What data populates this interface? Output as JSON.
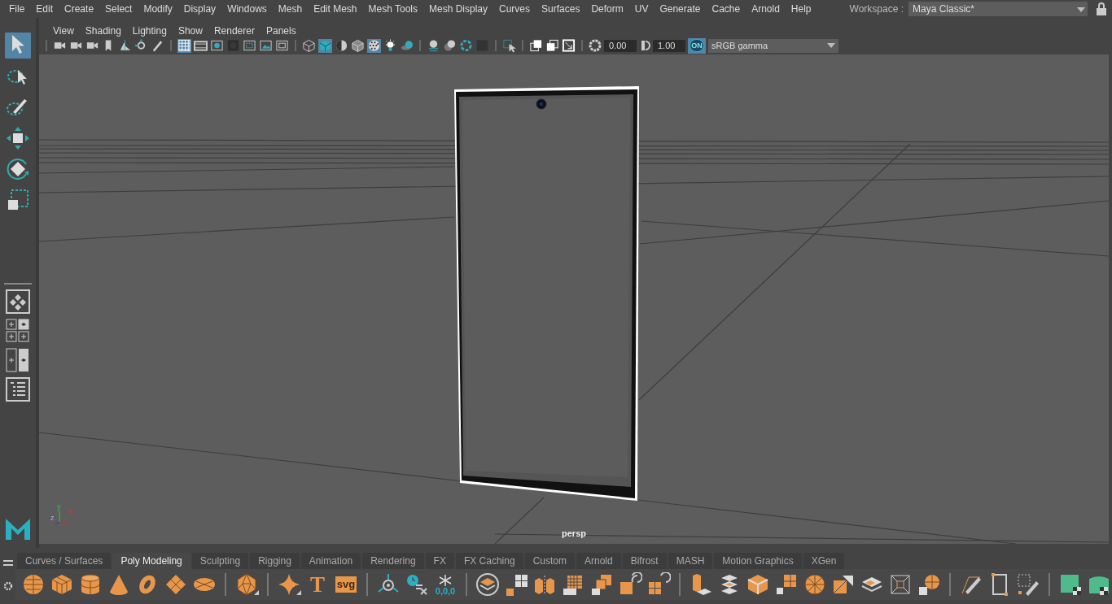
{
  "menu_bar": {
    "items": [
      "File",
      "Edit",
      "Create",
      "Select",
      "Modify",
      "Display",
      "Windows",
      "Mesh",
      "Edit Mesh",
      "Mesh Tools",
      "Mesh Display",
      "Curves",
      "Surfaces",
      "Deform",
      "UV",
      "Generate",
      "Cache",
      "Arnold",
      "Help"
    ],
    "workspace_label": "Workspace :",
    "workspace_value": "Maya Classic*"
  },
  "toolbox": {
    "tools": [
      {
        "selected": true
      },
      {
        "selected": false
      },
      {
        "selected": false
      },
      {
        "selected": false
      },
      {
        "selected": false
      },
      {
        "selected": false
      }
    ]
  },
  "panel_menu": [
    "View",
    "Shading",
    "Lighting",
    "Show",
    "Renderer",
    "Panels"
  ],
  "viewport_toolbar": {
    "toggles": [
      {
        "selected": false
      },
      {
        "selected": false
      },
      {
        "selected": false
      },
      {
        "selected": false
      },
      {
        "selected": false
      },
      {
        "selected": false
      },
      {
        "selected": false
      },
      {
        "selected": true
      },
      {
        "selected": false
      },
      {
        "selected": false
      },
      {
        "selected": false
      },
      {
        "selected": false
      },
      {
        "selected": false
      },
      {
        "selected": false
      },
      {
        "selected": false
      },
      {
        "selected": true
      },
      {
        "selected": false
      },
      {
        "selected": false
      },
      {
        "selected": true
      },
      {
        "selected": false
      },
      {
        "selected": false
      },
      {
        "selected": false
      },
      {
        "selected": false
      },
      {
        "selected": false
      },
      {
        "selected": false
      },
      {
        "selected": false
      },
      {
        "selected": false
      },
      {
        "selected": false
      },
      {
        "selected": false
      }
    ],
    "exposure": "0.00",
    "gamma": "1.00",
    "color_management": {
      "label": "ON",
      "on": true
    },
    "view_transform": "sRGB gamma"
  },
  "viewport": {
    "camera": "persp",
    "axis_labels": [
      "x",
      "y",
      "z"
    ]
  },
  "shelf": {
    "tabs": [
      {
        "label": "Curves / Surfaces",
        "selected": false
      },
      {
        "label": "Poly Modeling",
        "selected": true
      },
      {
        "label": "Sculpting",
        "selected": false
      },
      {
        "label": "Rigging",
        "selected": false
      },
      {
        "label": "Animation",
        "selected": false
      },
      {
        "label": "Rendering",
        "selected": false
      },
      {
        "label": "FX",
        "selected": false
      },
      {
        "label": "FX Caching",
        "selected": false
      },
      {
        "label": "Custom",
        "selected": false
      },
      {
        "label": "Arnold",
        "selected": false
      },
      {
        "label": "Bifrost",
        "selected": false
      },
      {
        "label": "MASH",
        "selected": false
      },
      {
        "label": "Motion Graphics",
        "selected": false
      },
      {
        "label": "XGen",
        "selected": false
      }
    ],
    "button_texts": [
      "T",
      "svg",
      "0,0,0"
    ]
  }
}
